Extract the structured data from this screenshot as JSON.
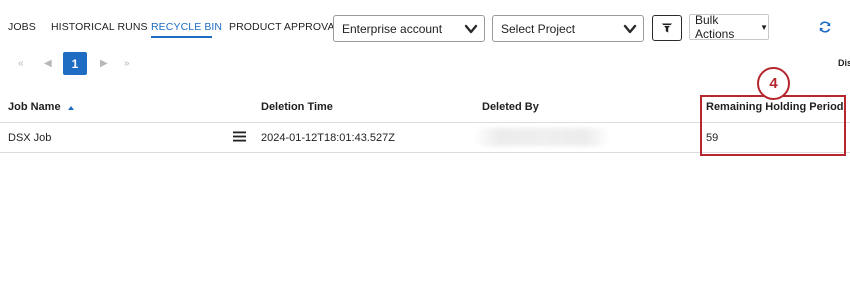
{
  "tabs": [
    {
      "label": "JOBS",
      "active": false
    },
    {
      "label": "HISTORICAL RUNS",
      "active": false
    },
    {
      "label": "RECYCLE BIN",
      "active": true
    },
    {
      "label": "PRODUCT APPROVAL",
      "active": false
    }
  ],
  "filters": {
    "account_dropdown": {
      "value": "Enterprise account",
      "icon": "chevron-down-icon"
    },
    "project_dropdown": {
      "value": "Select Project",
      "icon": "chevron-down-icon"
    },
    "filter_icon": "filter-funnel-icon",
    "bulk_actions": {
      "label": "Bulk Actions",
      "caret": "▼"
    },
    "refresh_icon": "refresh-icon"
  },
  "pagination": {
    "first_icon": "«",
    "prev_icon": "◀",
    "current_page": "1",
    "next_icon": "▶",
    "last_icon": "»",
    "truncated_label": "Dis"
  },
  "table": {
    "columns": [
      "Job Name",
      "Deletion Time",
      "Deleted By",
      "Remaining Holding Period"
    ],
    "sort": {
      "column": "Job Name",
      "direction": "ascending"
    },
    "rows": [
      {
        "job_name": "DSX Job",
        "deletion_time": "2024-01-12T18:01:43.527Z",
        "deleted_by": "",
        "remaining_holding_period": "59"
      }
    ]
  },
  "annotation": {
    "step_number": "4",
    "color": "#b5262e"
  },
  "colors": {
    "accent": "#1f6dc2",
    "callout": "#b5262e"
  }
}
